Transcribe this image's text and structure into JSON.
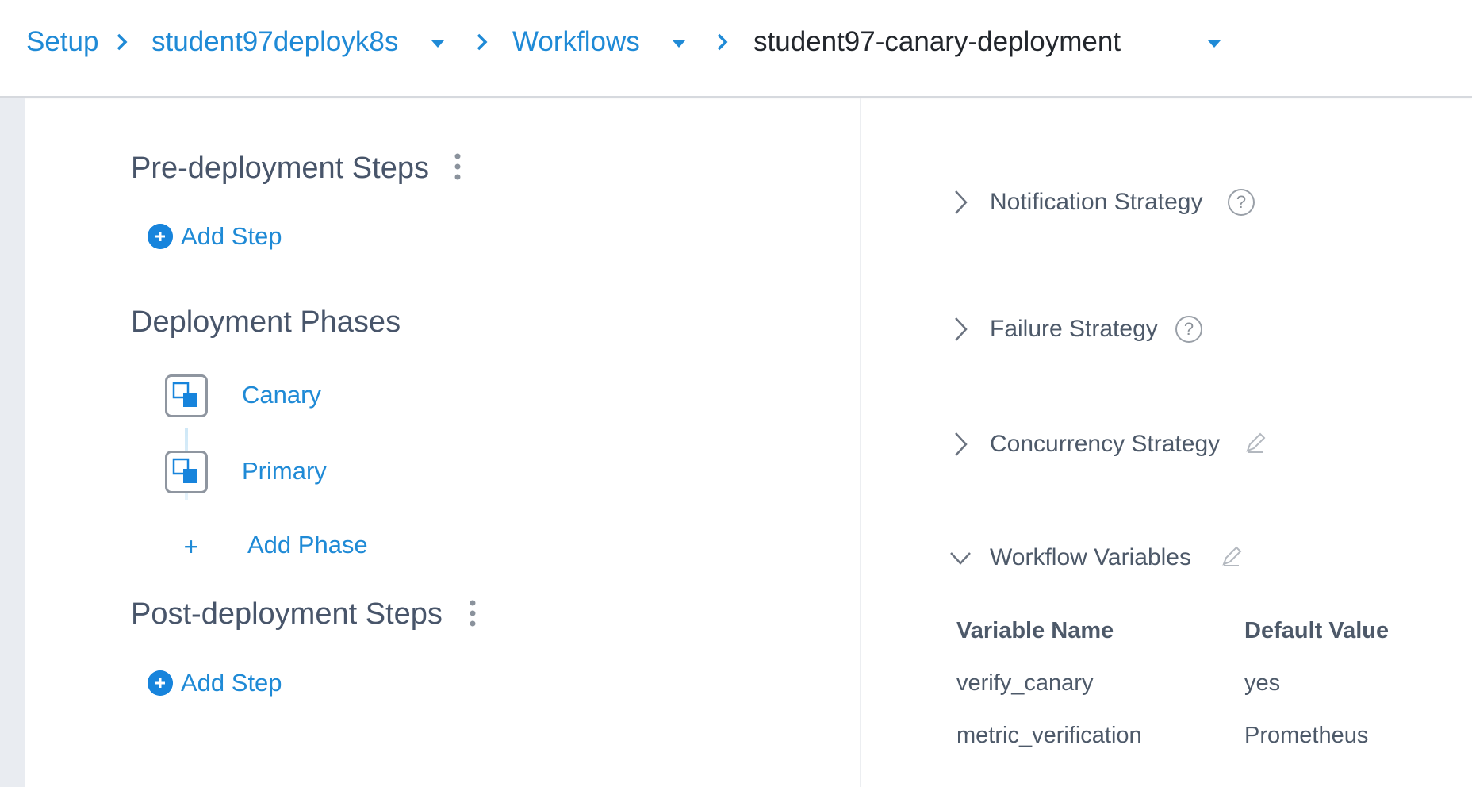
{
  "breadcrumb": {
    "items": [
      {
        "label": "Setup"
      },
      {
        "label": "student97deployk8s"
      },
      {
        "label": "Workflows"
      },
      {
        "label": "student97-canary-deployment"
      }
    ]
  },
  "workflow": {
    "pre_deployment": {
      "title": "Pre-deployment Steps",
      "add_step_label": "Add Step"
    },
    "deployment_phases": {
      "title": "Deployment Phases",
      "phases": [
        {
          "label": "Canary"
        },
        {
          "label": "Primary"
        }
      ],
      "add_phase_label": "Add Phase",
      "add_phase_symbol": "+"
    },
    "post_deployment": {
      "title": "Post-deployment Steps",
      "add_step_label": "Add Step"
    }
  },
  "side_panel": {
    "notification_strategy": "Notification Strategy",
    "failure_strategy": "Failure Strategy",
    "concurrency_strategy": "Concurrency Strategy",
    "workflow_variables": {
      "title": "Workflow Variables",
      "columns": [
        "Variable Name",
        "Default Value"
      ],
      "rows": [
        [
          "verify_canary",
          "yes"
        ],
        [
          "metric_verification",
          "Prometheus"
        ]
      ]
    },
    "help_glyph": "?"
  },
  "colors": {
    "link": "#1f8ad6",
    "accent": "#1784dc",
    "text": "#4a5568",
    "rail": "#e9ecf1"
  },
  "icons": [
    "chevron-right-icon",
    "caret-down-icon",
    "kebab-menu-icon",
    "plus-circle-icon",
    "phase-icon",
    "help-icon",
    "pencil-icon",
    "chevron-down-icon"
  ]
}
